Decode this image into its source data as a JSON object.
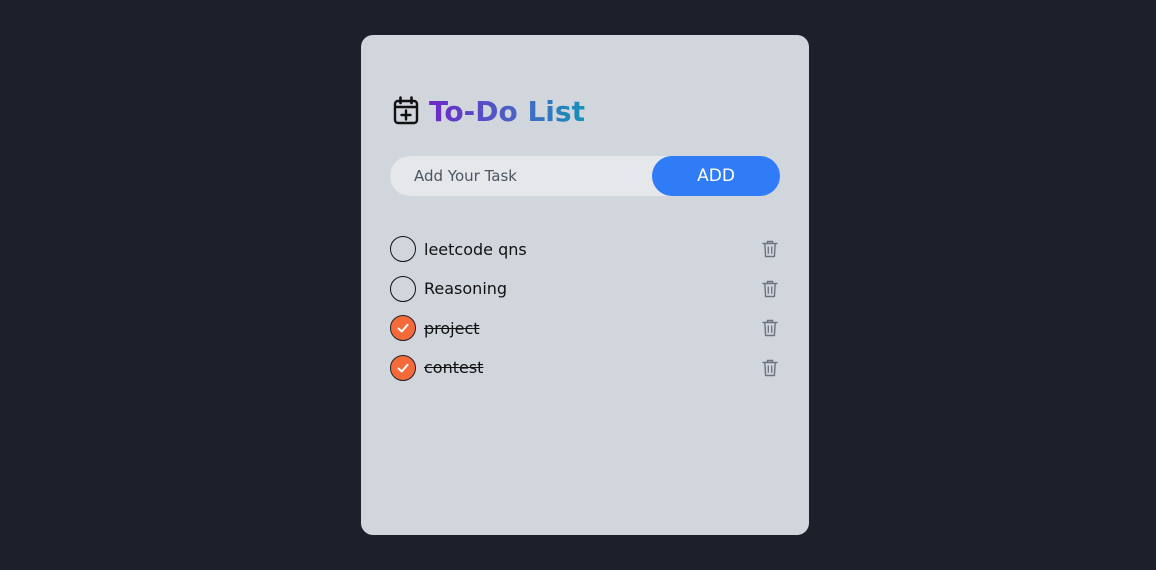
{
  "header": {
    "title": "To-Do List",
    "icon": "calendar-plus-icon"
  },
  "input": {
    "placeholder": "Add Your Task",
    "value": ""
  },
  "add_button": {
    "label": "ADD",
    "color": "#2f7cf6"
  },
  "tasks": [
    {
      "label": "leetcode qns",
      "completed": false
    },
    {
      "label": "Reasoning",
      "completed": false
    },
    {
      "label": "project",
      "completed": true
    },
    {
      "label": "contest",
      "completed": true
    }
  ],
  "colors": {
    "background": "#1d1f2b",
    "card": "#d1d5dc",
    "checked": "#f56a3a",
    "title_gradient": [
      "#6d28c9",
      "#1391b9"
    ]
  }
}
